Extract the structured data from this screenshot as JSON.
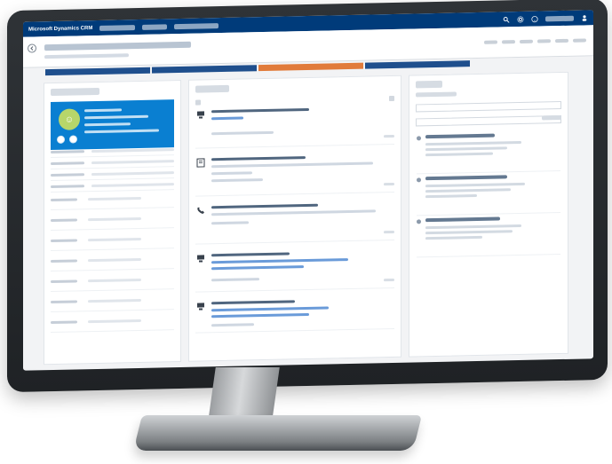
{
  "app": {
    "title": "Microsoft Dynamics CRM",
    "accent": "#003b7a",
    "status_colors": {
      "blue": "#1f4f8d",
      "orange": "#e17b3b",
      "card": "#0a7fd1",
      "avatar": "#b7d66a"
    }
  },
  "icons": {
    "back": "back-arrow-icon",
    "search": "search-icon",
    "settings": "gear-icon",
    "help": "help-icon",
    "user": "user-icon",
    "note": "note-icon",
    "task": "task-icon",
    "phone": "phone-icon",
    "device": "device-icon"
  }
}
